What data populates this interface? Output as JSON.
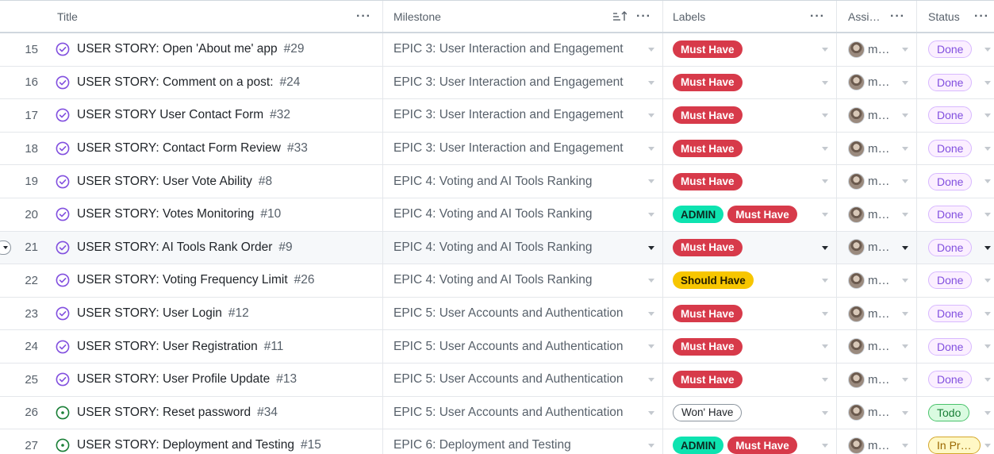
{
  "colors": {
    "must_have": "#d73a4a",
    "admin": "#0de3b0",
    "should_have": "#f7c600",
    "done": "#8250df",
    "todo": "#1a7f37",
    "in_progress": "#9a6700",
    "open_icon": "#1a7f37",
    "closed_icon": "#8250df"
  },
  "columns": {
    "title": "Title",
    "milestone": "Milestone",
    "labels": "Labels",
    "assignees": "Assi…",
    "status": "Status"
  },
  "icons": {
    "more": "…",
    "sort": "sort-ascending-icon",
    "issue_open": "issue-open-icon",
    "issue_closed": "issue-closed-icon"
  },
  "rows": [
    {
      "num": "15",
      "title": "USER STORY: Open 'About me' app",
      "issue": "#29",
      "state": "closed",
      "milestone": "EPIC 3: User Interaction and Engagement",
      "labels": [
        {
          "text": "Must Have",
          "kind": "must"
        }
      ],
      "assignee": "m…",
      "status": "Done",
      "status_kind": "done"
    },
    {
      "num": "16",
      "title": "USER STORY: Comment on a post:",
      "issue": "#24",
      "state": "closed",
      "milestone": "EPIC 3: User Interaction and Engagement",
      "labels": [
        {
          "text": "Must Have",
          "kind": "must"
        }
      ],
      "assignee": "m…",
      "status": "Done",
      "status_kind": "done"
    },
    {
      "num": "17",
      "title": "USER STORY User Contact Form",
      "issue": "#32",
      "state": "closed",
      "milestone": "EPIC 3: User Interaction and Engagement",
      "labels": [
        {
          "text": "Must Have",
          "kind": "must"
        }
      ],
      "assignee": "m…",
      "status": "Done",
      "status_kind": "done"
    },
    {
      "num": "18",
      "title": "USER STORY: Contact Form Review",
      "issue": "#33",
      "state": "closed",
      "milestone": "EPIC 3: User Interaction and Engagement",
      "labels": [
        {
          "text": "Must Have",
          "kind": "must"
        }
      ],
      "assignee": "m…",
      "status": "Done",
      "status_kind": "done"
    },
    {
      "num": "19",
      "title": "USER STORY: User Vote Ability",
      "issue": "#8",
      "state": "closed",
      "milestone": "EPIC 4: Voting and AI Tools Ranking",
      "labels": [
        {
          "text": "Must Have",
          "kind": "must"
        }
      ],
      "assignee": "m…",
      "status": "Done",
      "status_kind": "done"
    },
    {
      "num": "20",
      "title": "USER STORY: Votes Monitoring",
      "issue": "#10",
      "state": "closed",
      "milestone": "EPIC 4: Voting and AI Tools Ranking",
      "labels": [
        {
          "text": "ADMIN",
          "kind": "admin"
        },
        {
          "text": "Must Have",
          "kind": "must"
        }
      ],
      "assignee": "m…",
      "status": "Done",
      "status_kind": "done"
    },
    {
      "num": "21",
      "title": "USER STORY: AI Tools Rank Order",
      "issue": "#9",
      "state": "closed",
      "milestone": "EPIC 4: Voting and AI Tools Ranking",
      "labels": [
        {
          "text": "Must Have",
          "kind": "must"
        }
      ],
      "assignee": "m…",
      "status": "Done",
      "status_kind": "done",
      "hover": true
    },
    {
      "num": "22",
      "title": "USER STORY: Voting Frequency Limit",
      "issue": "#26",
      "state": "closed",
      "milestone": "EPIC 4: Voting and AI Tools Ranking",
      "labels": [
        {
          "text": "Should Have",
          "kind": "should"
        }
      ],
      "assignee": "m…",
      "status": "Done",
      "status_kind": "done"
    },
    {
      "num": "23",
      "title": "USER STORY: User Login",
      "issue": "#12",
      "state": "closed",
      "milestone": "EPIC 5: User Accounts and Authentication",
      "labels": [
        {
          "text": "Must Have",
          "kind": "must"
        }
      ],
      "assignee": "m…",
      "status": "Done",
      "status_kind": "done"
    },
    {
      "num": "24",
      "title": "USER STORY: User Registration",
      "issue": "#11",
      "state": "closed",
      "milestone": "EPIC 5: User Accounts and Authentication",
      "labels": [
        {
          "text": "Must Have",
          "kind": "must"
        }
      ],
      "assignee": "m…",
      "status": "Done",
      "status_kind": "done"
    },
    {
      "num": "25",
      "title": "USER STORY: User Profile Update",
      "issue": "#13",
      "state": "closed",
      "milestone": "EPIC 5: User Accounts and Authentication",
      "labels": [
        {
          "text": "Must Have",
          "kind": "must"
        }
      ],
      "assignee": "m…",
      "status": "Done",
      "status_kind": "done"
    },
    {
      "num": "26",
      "title": "USER STORY: Reset password",
      "issue": "#34",
      "state": "open",
      "milestone": "EPIC 5: User Accounts and Authentication",
      "labels": [
        {
          "text": "Won' Have",
          "kind": "wont"
        }
      ],
      "assignee": "m…",
      "status": "Todo",
      "status_kind": "todo"
    },
    {
      "num": "27",
      "title": "USER STORY: Deployment and Testing",
      "issue": "#15",
      "state": "open",
      "milestone": "EPIC 6: Deployment and Testing",
      "labels": [
        {
          "text": "ADMIN",
          "kind": "admin"
        },
        {
          "text": "Must Have",
          "kind": "must"
        }
      ],
      "assignee": "m…",
      "status": "In Pr…",
      "status_kind": "prog"
    }
  ]
}
